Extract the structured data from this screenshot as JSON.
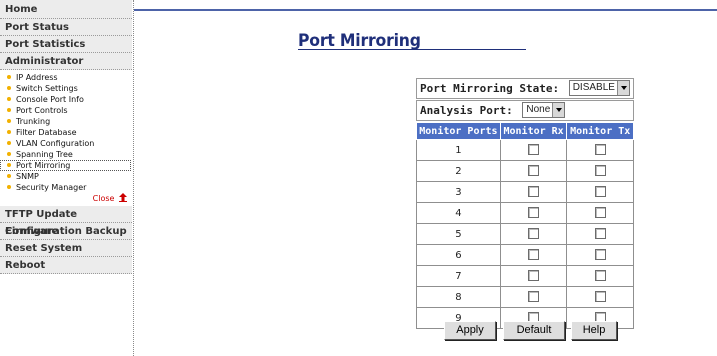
{
  "sidebar": {
    "top_items": [
      {
        "label": "Home"
      },
      {
        "label": "Port Status"
      },
      {
        "label": "Port Statistics"
      },
      {
        "label": "Administrator"
      }
    ],
    "sub_items": [
      {
        "label": "IP Address"
      },
      {
        "label": "Switch Settings"
      },
      {
        "label": "Console Port Info"
      },
      {
        "label": "Port Controls"
      },
      {
        "label": "Trunking"
      },
      {
        "label": "Filter Database"
      },
      {
        "label": "VLAN Configuration"
      },
      {
        "label": "Spanning Tree"
      },
      {
        "label": "Port Mirroring"
      },
      {
        "label": "SNMP"
      },
      {
        "label": "Security Manager"
      }
    ],
    "close_label": "Close",
    "bottom_items": [
      {
        "label": "TFTP Update Firmware"
      },
      {
        "label": "Configuration Backup"
      },
      {
        "label": "Reset System"
      },
      {
        "label": "Reboot"
      }
    ]
  },
  "page": {
    "title": "Port Mirroring"
  },
  "form": {
    "state_label": "Port Mirroring State:",
    "state_value": "DISABLE",
    "analysis_label": "Analysis Port:",
    "analysis_value": "None",
    "columns": [
      "Monitor Ports",
      "Monitor Rx",
      "Monitor Tx"
    ],
    "ports": [
      "1",
      "2",
      "3",
      "4",
      "5",
      "6",
      "7",
      "8",
      "9"
    ]
  },
  "buttons": {
    "apply": "Apply",
    "default": "Default",
    "help": "Help"
  },
  "colors": {
    "accent": "#4c6fc4",
    "title": "#1f2f7a",
    "bullet": "#f2b100"
  }
}
